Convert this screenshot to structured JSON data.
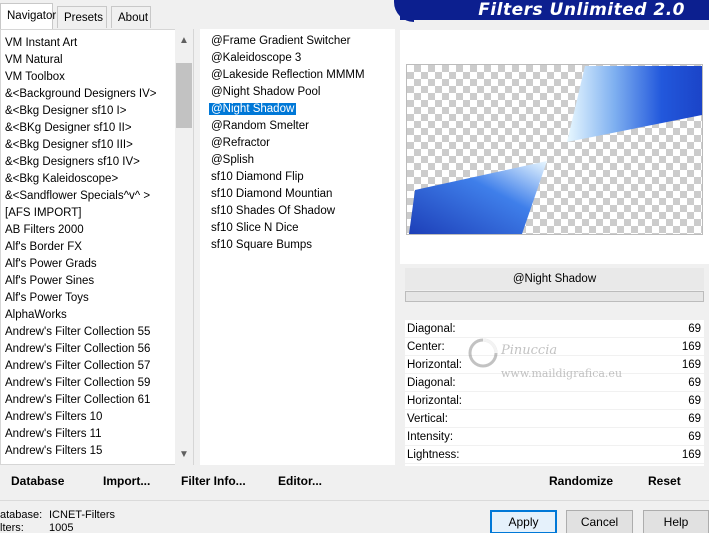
{
  "tabs": [
    {
      "label": "Navigator"
    },
    {
      "label": "Presets"
    },
    {
      "label": "About"
    }
  ],
  "banner": {
    "title": "Filters Unlimited 2.0"
  },
  "categories": [
    {
      "label": "VM Instant Art"
    },
    {
      "label": "VM Natural"
    },
    {
      "label": "VM Toolbox"
    },
    {
      "label": "&<Background Designers IV>"
    },
    {
      "label": "&<Bkg Designer sf10 I>"
    },
    {
      "label": "&<BKg Designer sf10 II>"
    },
    {
      "label": "&<Bkg Designer sf10 III>"
    },
    {
      "label": "&<Bkg Designers sf10 IV>"
    },
    {
      "label": "&<Bkg Kaleidoscope>"
    },
    {
      "label": "&<Sandflower Specials^v^ >"
    },
    {
      "label": "[AFS IMPORT]"
    },
    {
      "label": "AB Filters 2000"
    },
    {
      "label": "Alf's Border FX"
    },
    {
      "label": "Alf's Power Grads"
    },
    {
      "label": "Alf's Power Sines"
    },
    {
      "label": "Alf's Power Toys"
    },
    {
      "label": "AlphaWorks"
    },
    {
      "label": "Andrew's Filter Collection 55"
    },
    {
      "label": "Andrew's Filter Collection 56"
    },
    {
      "label": "Andrew's Filter Collection 57"
    },
    {
      "label": "Andrew's Filter Collection 59"
    },
    {
      "label": "Andrew's Filter Collection 61"
    },
    {
      "label": "Andrew's Filters 10"
    },
    {
      "label": "Andrew's Filters 11"
    },
    {
      "label": "Andrew's Filters 15"
    }
  ],
  "filters": [
    {
      "label": "@Frame Gradient Switcher"
    },
    {
      "label": "@Kaleidoscope 3"
    },
    {
      "label": "@Lakeside Reflection MMMM"
    },
    {
      "label": "@Night Shadow Pool"
    },
    {
      "label": "@Night Shadow"
    },
    {
      "label": "@Random Smelter"
    },
    {
      "label": "@Refractor"
    },
    {
      "label": "@Splish"
    },
    {
      "label": "sf10 Diamond Flip"
    },
    {
      "label": "sf10 Diamond Mountian"
    },
    {
      "label": "sf10 Shades Of Shadow"
    },
    {
      "label": "sf10 Slice N Dice"
    },
    {
      "label": "sf10 Square Bumps"
    }
  ],
  "selected_filter_name": "@Night Shadow",
  "params": [
    {
      "label": "Diagonal:",
      "value": "69"
    },
    {
      "label": "Center:",
      "value": "169"
    },
    {
      "label": "Horizontal:",
      "value": "169"
    },
    {
      "label": "Diagonal:",
      "value": "69"
    },
    {
      "label": "Horizontal:",
      "value": "69"
    },
    {
      "label": "Vertical:",
      "value": "69"
    },
    {
      "label": "Intensity:",
      "value": "69"
    },
    {
      "label": "Lightness:",
      "value": "169"
    }
  ],
  "watermark": {
    "name": "Pinuccia",
    "site": "www.maildigrafica.eu"
  },
  "buttons": {
    "database": "Database",
    "import": "Import...",
    "filter_info": "Filter Info...",
    "editor": "Editor...",
    "randomize": "Randomize",
    "reset": "Reset",
    "apply": "Apply",
    "cancel": "Cancel",
    "help": "Help"
  },
  "status": {
    "database_label": "atabase:",
    "database_value": "ICNET-Filters",
    "filters_label": "lters:",
    "filters_value": "1005"
  },
  "colors": {
    "banner": "#0c1f8f",
    "selection": "#0078d7",
    "preview_blue": "#1e50d8"
  },
  "icons": {
    "scroll_up": "▲",
    "scroll_down": "▼"
  }
}
